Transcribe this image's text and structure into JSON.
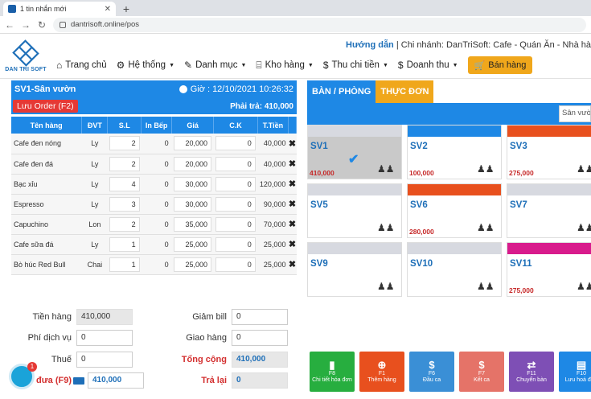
{
  "browser": {
    "tab_title": "1 tin nhắn mới",
    "url": "dantrisoft.online/pos"
  },
  "header": {
    "logo_text": "DAN TRI SOFT",
    "help": "Hướng dẫn",
    "branch": "| Chi nhánh: DanTriSoft: Cafe - Quán Ăn - Nhà hàng M",
    "nav": [
      {
        "label": "Trang chủ",
        "icon": "home-icon"
      },
      {
        "label": "Hệ thống",
        "icon": "gear-icon"
      },
      {
        "label": "Danh mục",
        "icon": "wrench-icon"
      },
      {
        "label": "Kho hàng",
        "icon": "warehouse-icon"
      },
      {
        "label": "Thu chi tiền",
        "icon": "dollar-icon"
      },
      {
        "label": "Doanh thu",
        "icon": "dollar-icon"
      }
    ],
    "sell_button": "Bán hàng"
  },
  "order": {
    "table": "SV1-Sân vườn",
    "time": "Giờ : 12/10/2021 10:26:32",
    "save_button": "Lưu Order (F2)",
    "payable": "Phải trả: 410,000",
    "columns": [
      "Tên hàng",
      "ĐVT",
      "S.L",
      "In Bếp",
      "Giá",
      "C.K",
      "T.Tiền"
    ],
    "rows": [
      {
        "name": "Cafe đen nóng",
        "unit": "Ly",
        "qty": "2",
        "kitchen": "0",
        "price": "20,000",
        "discount": "0",
        "total": "40,000"
      },
      {
        "name": "Cafe đen đá",
        "unit": "Ly",
        "qty": "2",
        "kitchen": "0",
        "price": "20,000",
        "discount": "0",
        "total": "40,000"
      },
      {
        "name": "Bạc xỉu",
        "unit": "Ly",
        "qty": "4",
        "kitchen": "0",
        "price": "30,000",
        "discount": "0",
        "total": "120,000"
      },
      {
        "name": "Espresso",
        "unit": "Ly",
        "qty": "3",
        "kitchen": "0",
        "price": "30,000",
        "discount": "0",
        "total": "90,000"
      },
      {
        "name": "Capuchino",
        "unit": "Lon",
        "qty": "2",
        "kitchen": "0",
        "price": "35,000",
        "discount": "0",
        "total": "70,000"
      },
      {
        "name": "Cafe sữa đá",
        "unit": "Ly",
        "qty": "1",
        "kitchen": "0",
        "price": "25,000",
        "discount": "0",
        "total": "25,000"
      },
      {
        "name": "Bò húc Red Bull",
        "unit": "Chai",
        "qty": "1",
        "kitchen": "0",
        "price": "25,000",
        "discount": "0",
        "total": "25,000"
      }
    ]
  },
  "totals": {
    "subtotal_label": "Tiền hàng",
    "subtotal": "410,000",
    "service_label": "Phí dịch vụ",
    "service": "0",
    "tax_label": "Thuế",
    "tax": "0",
    "paid_label": "đưa (F9)",
    "paid": "410,000",
    "discount_label": "Giảm bill",
    "discount": "0",
    "delivery_label": "Giao hàng",
    "delivery": "0",
    "grand_label": "Tổng cộng",
    "grand": "410,000",
    "change_label": "Trả lại",
    "change": "0"
  },
  "chat": {
    "badge": "1"
  },
  "tables_panel": {
    "tab_rooms": "BÀN / PHÒNG",
    "tab_menu": "THỰC ĐƠN",
    "search_value": "Sân vườn",
    "tables": [
      {
        "name": "SV1",
        "amount": "410,000",
        "strip": "#d7d9e0",
        "selected": true
      },
      {
        "name": "SV2",
        "amount": "100,000",
        "strip": "#1e88e5",
        "selected": false
      },
      {
        "name": "SV3",
        "amount": "275,000",
        "strip": "#e8501e",
        "selected": false
      },
      {
        "name": "SV5",
        "amount": "",
        "strip": "#d7d9e0",
        "selected": false
      },
      {
        "name": "SV6",
        "amount": "280,000",
        "strip": "#e8501e",
        "selected": false
      },
      {
        "name": "SV7",
        "amount": "",
        "strip": "#d7d9e0",
        "selected": false
      },
      {
        "name": "SV9",
        "amount": "",
        "strip": "#d7d9e0",
        "selected": false
      },
      {
        "name": "SV10",
        "amount": "",
        "strip": "#d7d9e0",
        "selected": false
      },
      {
        "name": "SV11",
        "amount": "275,000",
        "strip": "#d81b8c",
        "selected": false
      }
    ]
  },
  "functions": [
    {
      "key": "F8",
      "label": "Chi tiết hóa đơn",
      "color": "#27ae3f",
      "icon": "document-icon",
      "glyph": "▮"
    },
    {
      "key": "F1",
      "label": "Thêm hàng",
      "color": "#e8501e",
      "icon": "plus-icon",
      "glyph": "⊕"
    },
    {
      "key": "F6",
      "label": "Đầu ca",
      "color": "#3a8fd6",
      "icon": "dollar-icon",
      "glyph": "$"
    },
    {
      "key": "F7",
      "label": "Kết ca",
      "color": "#e57368",
      "icon": "dollar-icon",
      "glyph": "$"
    },
    {
      "key": "F11",
      "label": "Chuyển bàn",
      "color": "#7e4fb5",
      "icon": "swap-icon",
      "glyph": "⇄"
    },
    {
      "key": "F10",
      "label": "Lưu hoá đơn",
      "color": "#1e88e5",
      "icon": "save-icon",
      "glyph": "▤"
    }
  ]
}
